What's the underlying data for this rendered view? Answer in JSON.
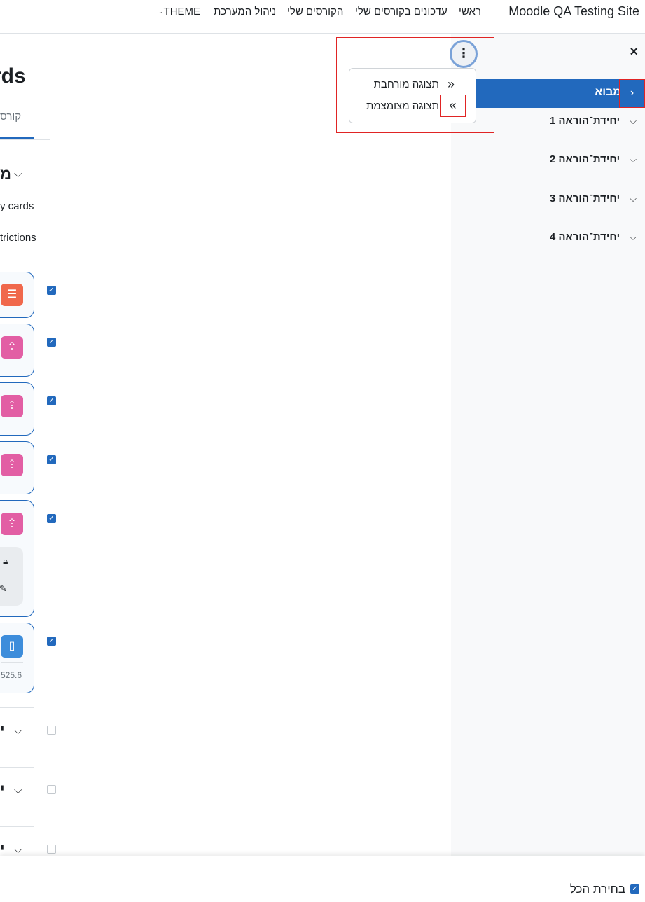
{
  "nav": {
    "site_name": "Moodle QA Testing Site",
    "items": [
      "ראשי",
      "עדכונים בקורסים שלי",
      "הקורסים שלי",
      "ניהול המערכת",
      "THEME"
    ]
  },
  "drawer": {
    "close_icon": "×",
    "active_item": "מבוא",
    "items": [
      "יחידת־הוראה 1",
      "יחידת־הוראה 2",
      "יחידת־הוראה 3",
      "יחידת־הוראה 4"
    ]
  },
  "menu": {
    "kebab": "⋮",
    "expanded_label": "תצוגה מורחבת",
    "collapsed_label": "תצוגה מצומצמת",
    "expanded_icon": "double-chevron-down-icon",
    "collapsed_icon": "double-chevron-left-icon"
  },
  "main": {
    "title_fragment": "rds",
    "tab_fragment": "קורס",
    "section_letter": "מ",
    "meta_1": "y cards",
    "meta_2": "trictions",
    "file_size": "525.6",
    "section_marks": [
      "י",
      "י",
      "י"
    ]
  },
  "bottom": {
    "select_all_label": "בחירת הכל"
  },
  "colors": {
    "brand": "#2269bd",
    "highlight": "#e02424",
    "forum": "#f0684c",
    "assignment": "#e25ea4",
    "file": "#3d8ddb"
  }
}
